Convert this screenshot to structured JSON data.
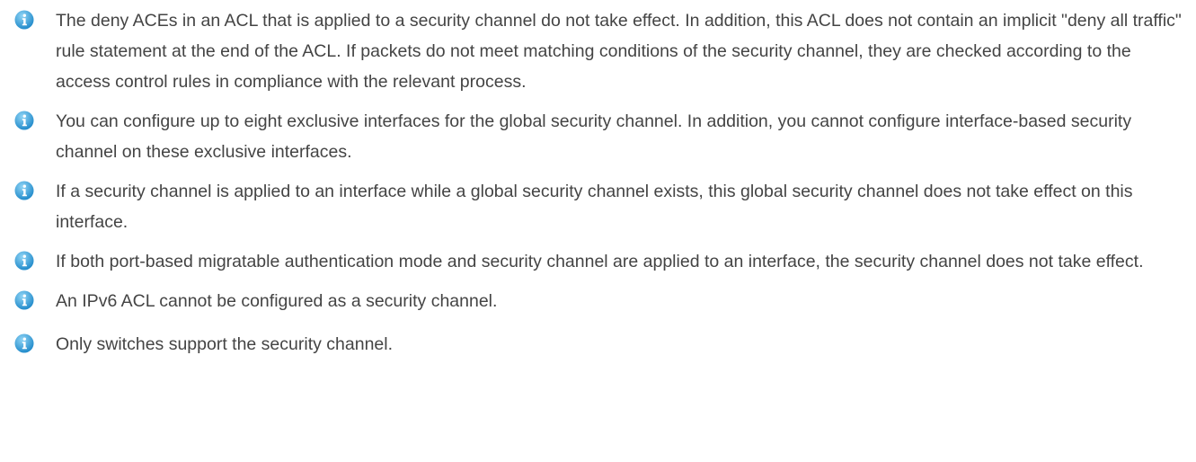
{
  "notes": [
    {
      "icon": "info-icon",
      "text": "The deny ACEs in an ACL that is applied to a security channel do not take effect. In addition, this ACL does not contain an implicit \"deny all traffic\" rule statement at the end of the ACL. If packets do not meet matching conditions of the security channel, they are checked according to the access control rules in compliance with the relevant process."
    },
    {
      "icon": "info-icon",
      "text": "You can configure up to eight exclusive interfaces for the global security channel. In addition, you cannot configure interface-based security channel on these exclusive interfaces."
    },
    {
      "icon": "info-icon",
      "text": "If a security channel is applied to an interface while a global security channel exists, this global security channel does not take effect on this interface."
    },
    {
      "icon": "info-icon",
      "text": "If both port-based migratable authentication mode and security channel are applied to an interface, the security channel does not take effect."
    },
    {
      "icon": "info-icon",
      "text": "An IPv6 ACL cannot be configured as a security channel."
    },
    {
      "icon": "info-icon",
      "text": "Only switches support the security channel."
    }
  ],
  "colors": {
    "text": "#444444",
    "icon_light": "#6ec3ee",
    "icon_dark": "#1a86c8"
  }
}
